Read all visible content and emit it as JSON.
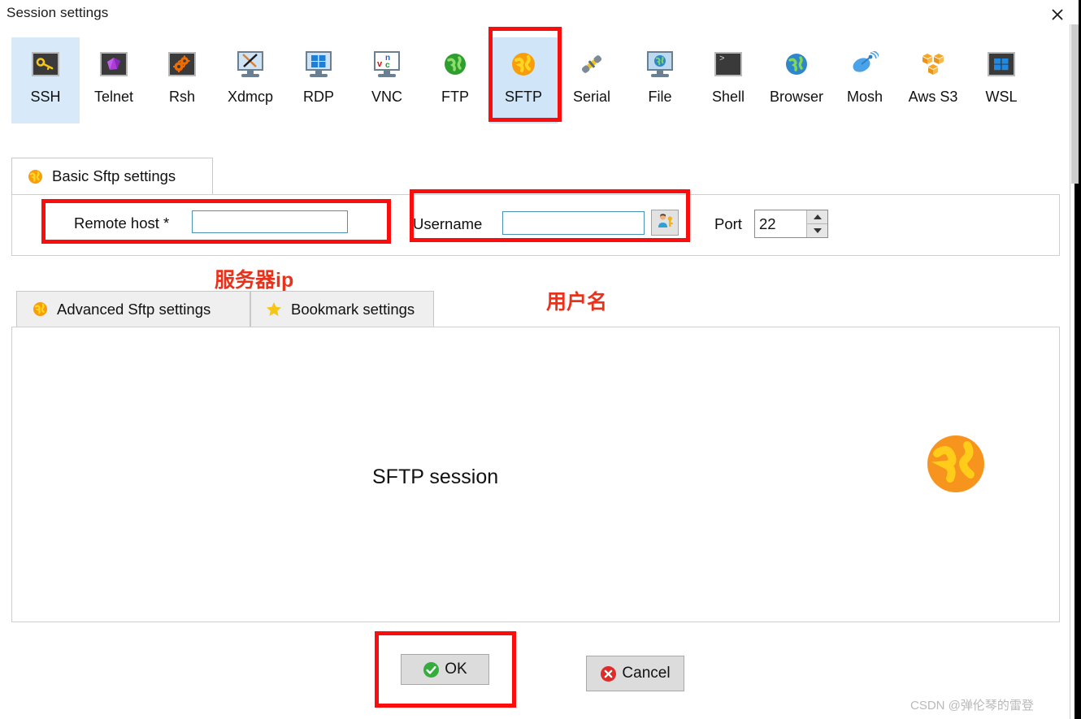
{
  "window": {
    "title": "Session settings",
    "close_icon": "close-icon"
  },
  "toolbar": {
    "items": [
      {
        "label": "SSH",
        "icon": "key-icon",
        "selected": true
      },
      {
        "label": "Telnet",
        "icon": "purple-cube-icon",
        "selected": false
      },
      {
        "label": "Rsh",
        "icon": "gears-icon",
        "selected": false
      },
      {
        "label": "Xdmcp",
        "icon": "x-monitor-icon",
        "selected": false
      },
      {
        "label": "RDP",
        "icon": "windows-monitor-icon",
        "selected": false
      },
      {
        "label": "VNC",
        "icon": "vnc-monitor-icon",
        "selected": false
      },
      {
        "label": "FTP",
        "icon": "green-globe-icon",
        "selected": false
      },
      {
        "label": "SFTP",
        "icon": "orange-globe-icon",
        "selected": true
      },
      {
        "label": "Serial",
        "icon": "plug-icon",
        "selected": false
      },
      {
        "label": "File",
        "icon": "file-monitor-icon",
        "selected": false
      },
      {
        "label": "Shell",
        "icon": "terminal-icon",
        "selected": false
      },
      {
        "label": "Browser",
        "icon": "blue-globe-icon",
        "selected": false
      },
      {
        "label": "Mosh",
        "icon": "satellite-icon",
        "selected": false
      },
      {
        "label": "Aws S3",
        "icon": "aws-cubes-icon",
        "selected": false
      },
      {
        "label": "WSL",
        "icon": "windows-icon",
        "selected": false
      }
    ]
  },
  "basic_tab": {
    "label": "Basic Sftp settings",
    "icon": "orange-globe-icon"
  },
  "form": {
    "remote_host_label": "Remote host *",
    "remote_host_value": "",
    "remote_host_placeholder": "",
    "username_label": "Username",
    "username_value": "",
    "username_placeholder": "",
    "username_browse_icon": "user-key-icon",
    "port_label": "Port",
    "port_value": "22"
  },
  "annotations": [
    {
      "text": "服务器ip",
      "target": "remote-host"
    },
    {
      "text": "用户名",
      "target": "username"
    }
  ],
  "bottom_tabs": [
    {
      "label": "Advanced Sftp settings",
      "icon": "orange-globe-icon",
      "active": false
    },
    {
      "label": "Bookmark settings",
      "icon": "star-icon",
      "active": false
    }
  ],
  "main_panel": {
    "session_text": "SFTP session",
    "illustration_icon": "orange-globe-icon"
  },
  "buttons": {
    "ok_label": "OK",
    "ok_icon": "green-check-icon",
    "cancel_label": "Cancel",
    "cancel_icon": "red-x-icon"
  },
  "watermark": "CSDN @弹伦琴的雷登",
  "colors": {
    "annotation_red": "#fb0d0d",
    "annotation_text_red": "#e8321c",
    "selected_tool_bg": "#d8eaf9",
    "input_border": "#4a93b5",
    "orange_globe": "#f99e0b",
    "button_face": "#dcdcdc"
  }
}
